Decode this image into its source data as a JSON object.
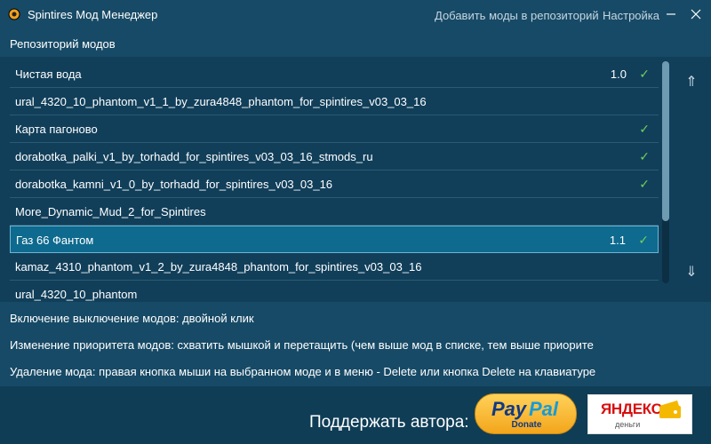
{
  "window": {
    "title": "Spintires Мод Менеджер",
    "links": [
      "Добавить моды в репозиторий",
      "Настройка"
    ]
  },
  "repository": {
    "label": "Репозиторий модов",
    "mods": [
      {
        "name": "Чистая вода",
        "version": "1.0",
        "enabled": true,
        "selected": false
      },
      {
        "name": "ural_4320_10_phantom_v1_1_by_zura4848_phantom_for_spintires_v03_03_16",
        "version": "",
        "enabled": false,
        "selected": false
      },
      {
        "name": "Карта пагоново",
        "version": "",
        "enabled": true,
        "selected": false
      },
      {
        "name": "dorabotka_palki_v1_by_torhadd_for_spintires_v03_03_16_stmods_ru",
        "version": "",
        "enabled": true,
        "selected": false
      },
      {
        "name": "dorabotka_kamni_v1_0_by_torhadd_for_spintires_v03_03_16",
        "version": "",
        "enabled": true,
        "selected": false
      },
      {
        "name": "More_Dynamic_Mud_2_for_Spintires",
        "version": "",
        "enabled": false,
        "selected": false
      },
      {
        "name": "Газ 66 Фантом",
        "version": "1.1",
        "enabled": true,
        "selected": true
      },
      {
        "name": "kamaz_4310_phantom_v1_2_by_zura4848_phantom_for_spintires_v03_03_16",
        "version": "",
        "enabled": false,
        "selected": false
      },
      {
        "name": "ural_4320_10_phantom",
        "version": "",
        "enabled": false,
        "selected": false
      }
    ],
    "check_glyph": "✓",
    "scroll_up": "⇑",
    "scroll_down": "⇓"
  },
  "help": [
    "Включение выключение модов: двойной клик",
    "Изменение приоритета модов: схватить мышкой и перетащить (чем выше мод в списке, тем выше приорите",
    "Удаление мода: правая кнопка мыши на выбранном моде и в меню - Delete или кнопка Delete на клавиатуре"
  ],
  "support": {
    "label": "Поддержать автора:",
    "paypal": {
      "pay": "Pay",
      "pal": "Pal",
      "donate": "Donate"
    },
    "yandex": {
      "word": "ЯНДЕКС",
      "sub": "деньги"
    }
  },
  "colors": {
    "background": "#174a66",
    "list_background": "#113f5a",
    "selected_row": "#0e6a8e",
    "check": "#6fd15a"
  },
  "icons": {
    "app": "spintires-gear-icon",
    "minimize": "minimize-icon",
    "close": "close-icon"
  }
}
